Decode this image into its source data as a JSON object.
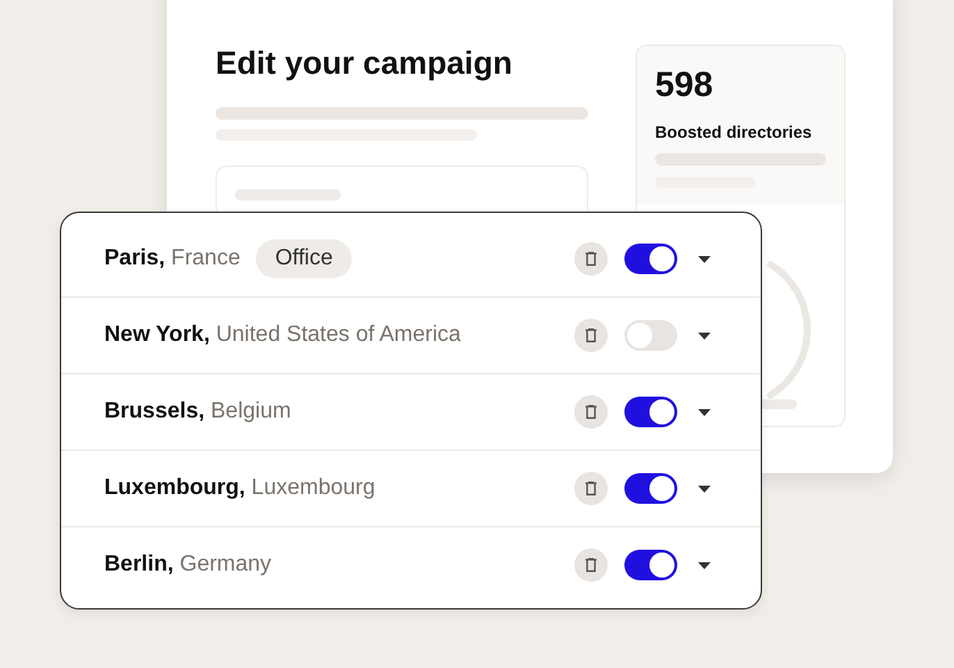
{
  "campaign": {
    "title": "Edit your campaign"
  },
  "stat": {
    "value": "598",
    "label": "Boosted directories"
  },
  "locations": [
    {
      "city": "Paris,",
      "country": "France",
      "tag": "Office",
      "enabled": true
    },
    {
      "city": "New York,",
      "country": "United States of America",
      "enabled": false
    },
    {
      "city": "Brussels,",
      "country": "Belgium",
      "enabled": true
    },
    {
      "city": "Luxembourg,",
      "country": "Luxembourg",
      "enabled": true
    },
    {
      "city": "Berlin,",
      "country": "Germany",
      "enabled": true
    }
  ]
}
